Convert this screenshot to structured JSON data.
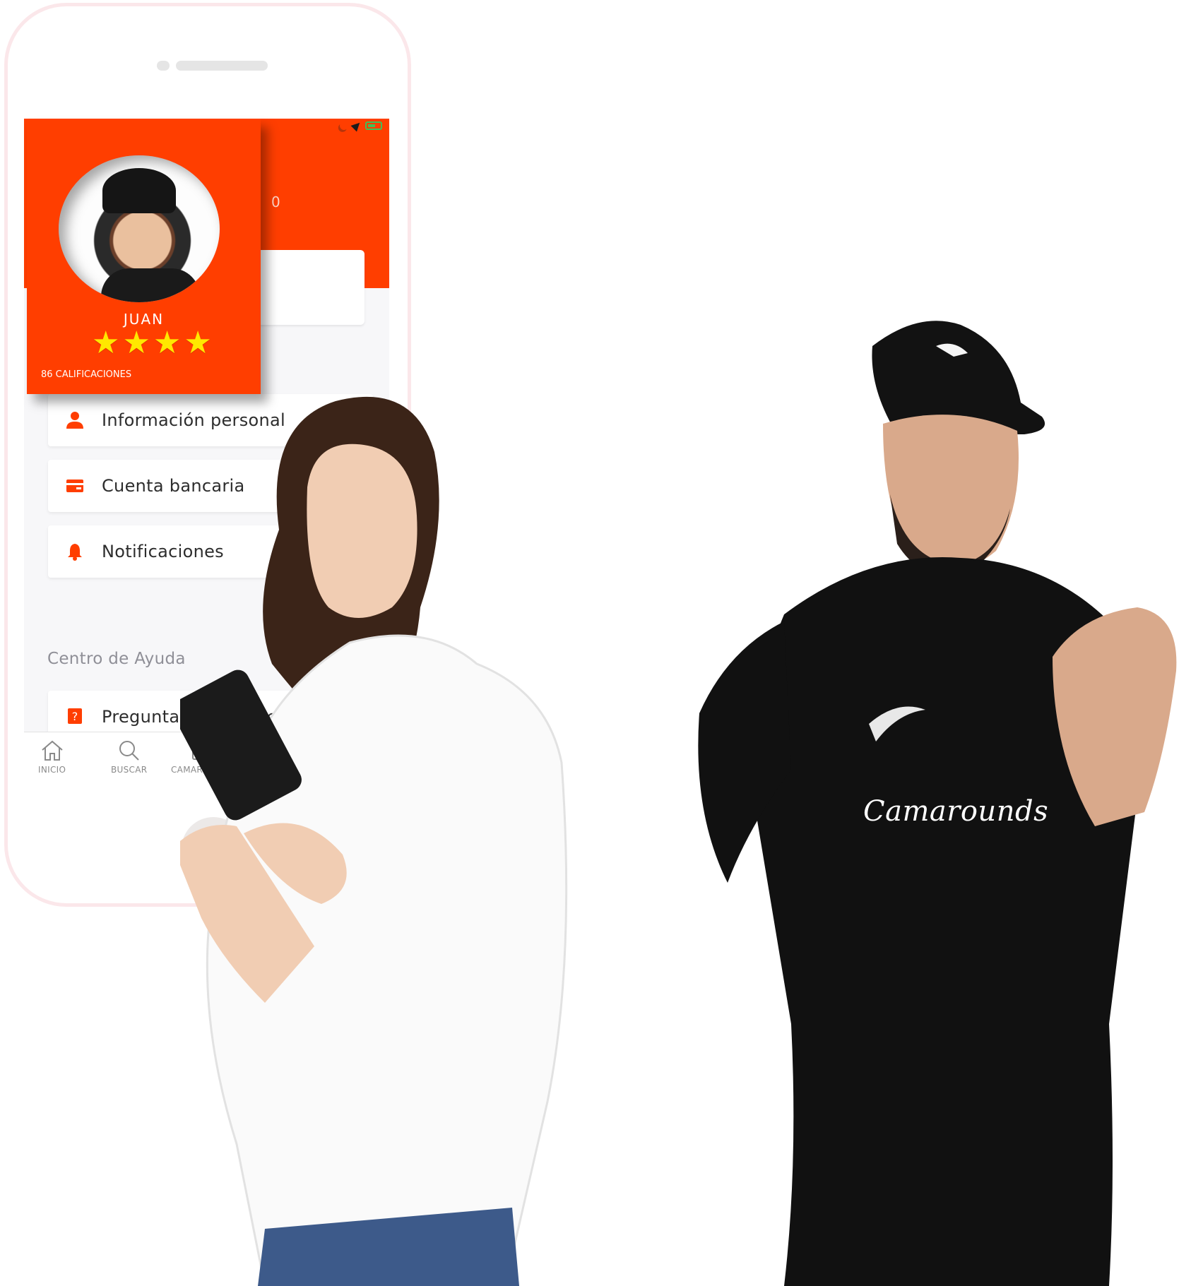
{
  "phone": {
    "status_bar": {
      "icons": [
        "moon-icon",
        "location-arrow-icon",
        "battery-charging-icon"
      ]
    },
    "rating_count": "0",
    "profile_card": {
      "name": "JUAN",
      "stars": 4,
      "ratings_label": "86 CALIFICACIONES"
    },
    "menu": [
      {
        "label": "Información personal",
        "icon": "user-icon"
      },
      {
        "label": "Cuenta bancaria",
        "icon": "credit-card-icon"
      },
      {
        "label": "Notificaciones",
        "icon": "bell-icon"
      }
    ],
    "help_section": {
      "title": "Centro de Ayuda",
      "items": [
        {
          "label": "Preguntas frecuentes",
          "icon": "question-icon"
        }
      ]
    },
    "tabbar": [
      {
        "label": "INICIO",
        "icon": "home-icon"
      },
      {
        "label": "BUSCAR",
        "icon": "search-icon"
      },
      {
        "label": "CAMAROUNDS",
        "icon": "briefcase-icon"
      }
    ]
  },
  "brand": {
    "shirt_text": "Camarounds"
  },
  "colors": {
    "accent": "#ff3e00",
    "star": "#ffe800",
    "background": "#ffffff"
  }
}
